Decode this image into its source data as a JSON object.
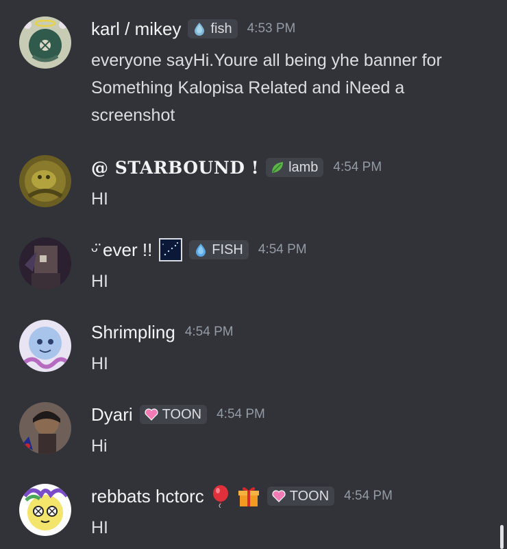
{
  "messages": [
    {
      "author": "karl / mikey",
      "tag": "fish",
      "time": "4:53 PM",
      "text": "everyone sayHi.Youre all being yhe banner for Something Kalopisa Related and iNeed a screenshot"
    },
    {
      "author": "@ STARBOUND !",
      "tag": "lamb",
      "time": "4:54 PM",
      "text": "HI"
    },
    {
      "author": "ᵕ̈ ever !!",
      "tag": "FISH",
      "time": "4:54 PM",
      "text": "HI"
    },
    {
      "author": "Shrimpling",
      "time": "4:54 PM",
      "text": "HI"
    },
    {
      "author": "Dyari",
      "tag": "TOON",
      "time": "4:54 PM",
      "text": "Hi"
    },
    {
      "author": "rebbats hctorc",
      "tag": "TOON",
      "time": "4:54 PM",
      "text": "HI"
    }
  ],
  "colors": {
    "background": "#313338",
    "name": "#f2f3f5",
    "text": "#dbdee1",
    "timestamp": "#949ba4",
    "tag_background": "#41434a"
  },
  "icons": {
    "fish_tag": "water-drop-icon",
    "lamb_tag": "leaf-icon",
    "toon_tag": "pink-heart-icon"
  }
}
